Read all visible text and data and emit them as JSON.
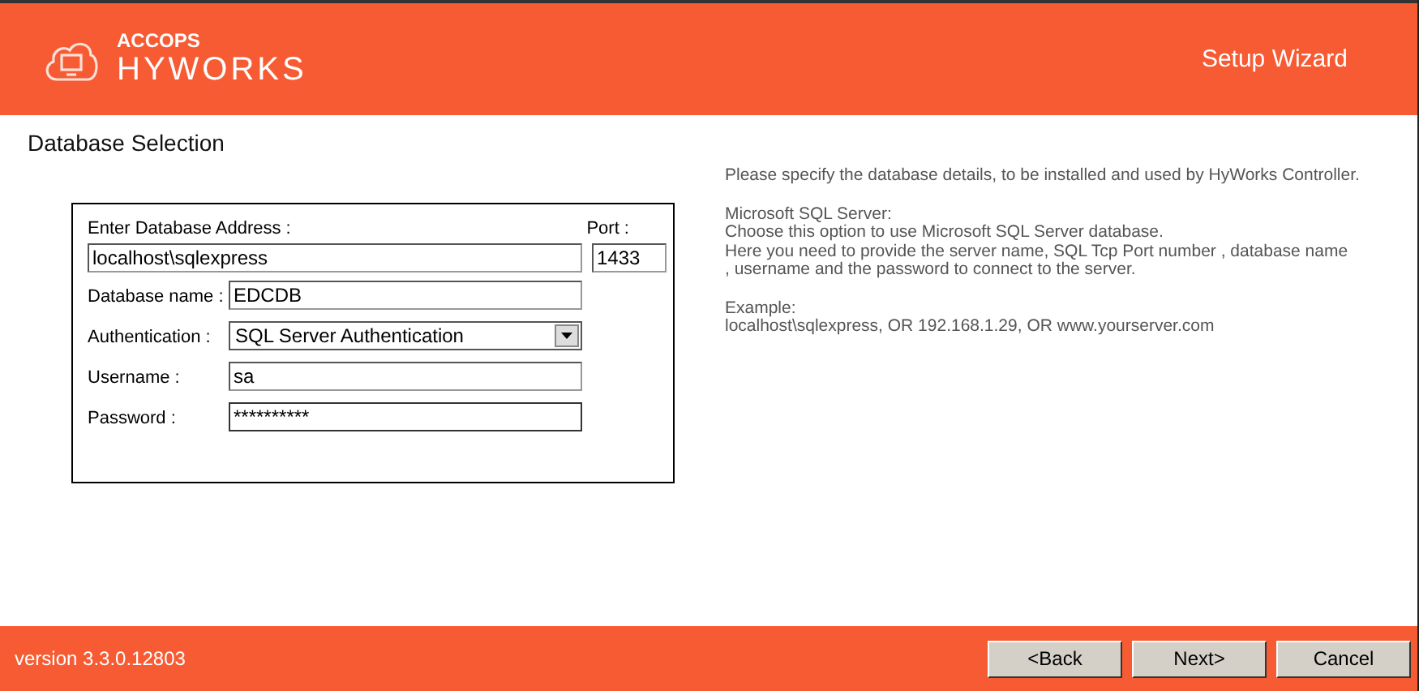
{
  "header": {
    "brand_top": "ACCOPS",
    "brand_bottom": "HYWORKS",
    "title": "Setup Wizard"
  },
  "page_title": "Database Selection",
  "form": {
    "address_label": "Enter Database Address :",
    "address": "localhost\\sqlexpress",
    "port_label": "Port :",
    "port": "1433",
    "rows": [
      {
        "kind": "input",
        "label": "Database name :",
        "value": "EDCDB"
      },
      {
        "kind": "select",
        "label": "Authentication :",
        "value": "SQL Server Authentication"
      },
      {
        "kind": "input",
        "label": "Username :",
        "value": "sa"
      },
      {
        "kind": "input",
        "label": "Password :",
        "value": "**********",
        "focused": true
      }
    ]
  },
  "help": [
    [
      "Please specify the database details, to be installed and used by HyWorks Controller."
    ],
    [
      "Microsoft SQL Server:",
      "Choose this option to use Microsoft SQL Server database.",
      "Here you need to provide the server name,  SQL Tcp Port number , database name",
      ", username and the password to connect to the server."
    ],
    [
      "Example:",
      "localhost\\sqlexpress, OR 192.168.1.29, OR www.yourserver.com"
    ]
  ],
  "footer": {
    "version": "version 3.3.0.12803",
    "buttons": [
      "<Back",
      "Next>",
      "Cancel"
    ]
  }
}
